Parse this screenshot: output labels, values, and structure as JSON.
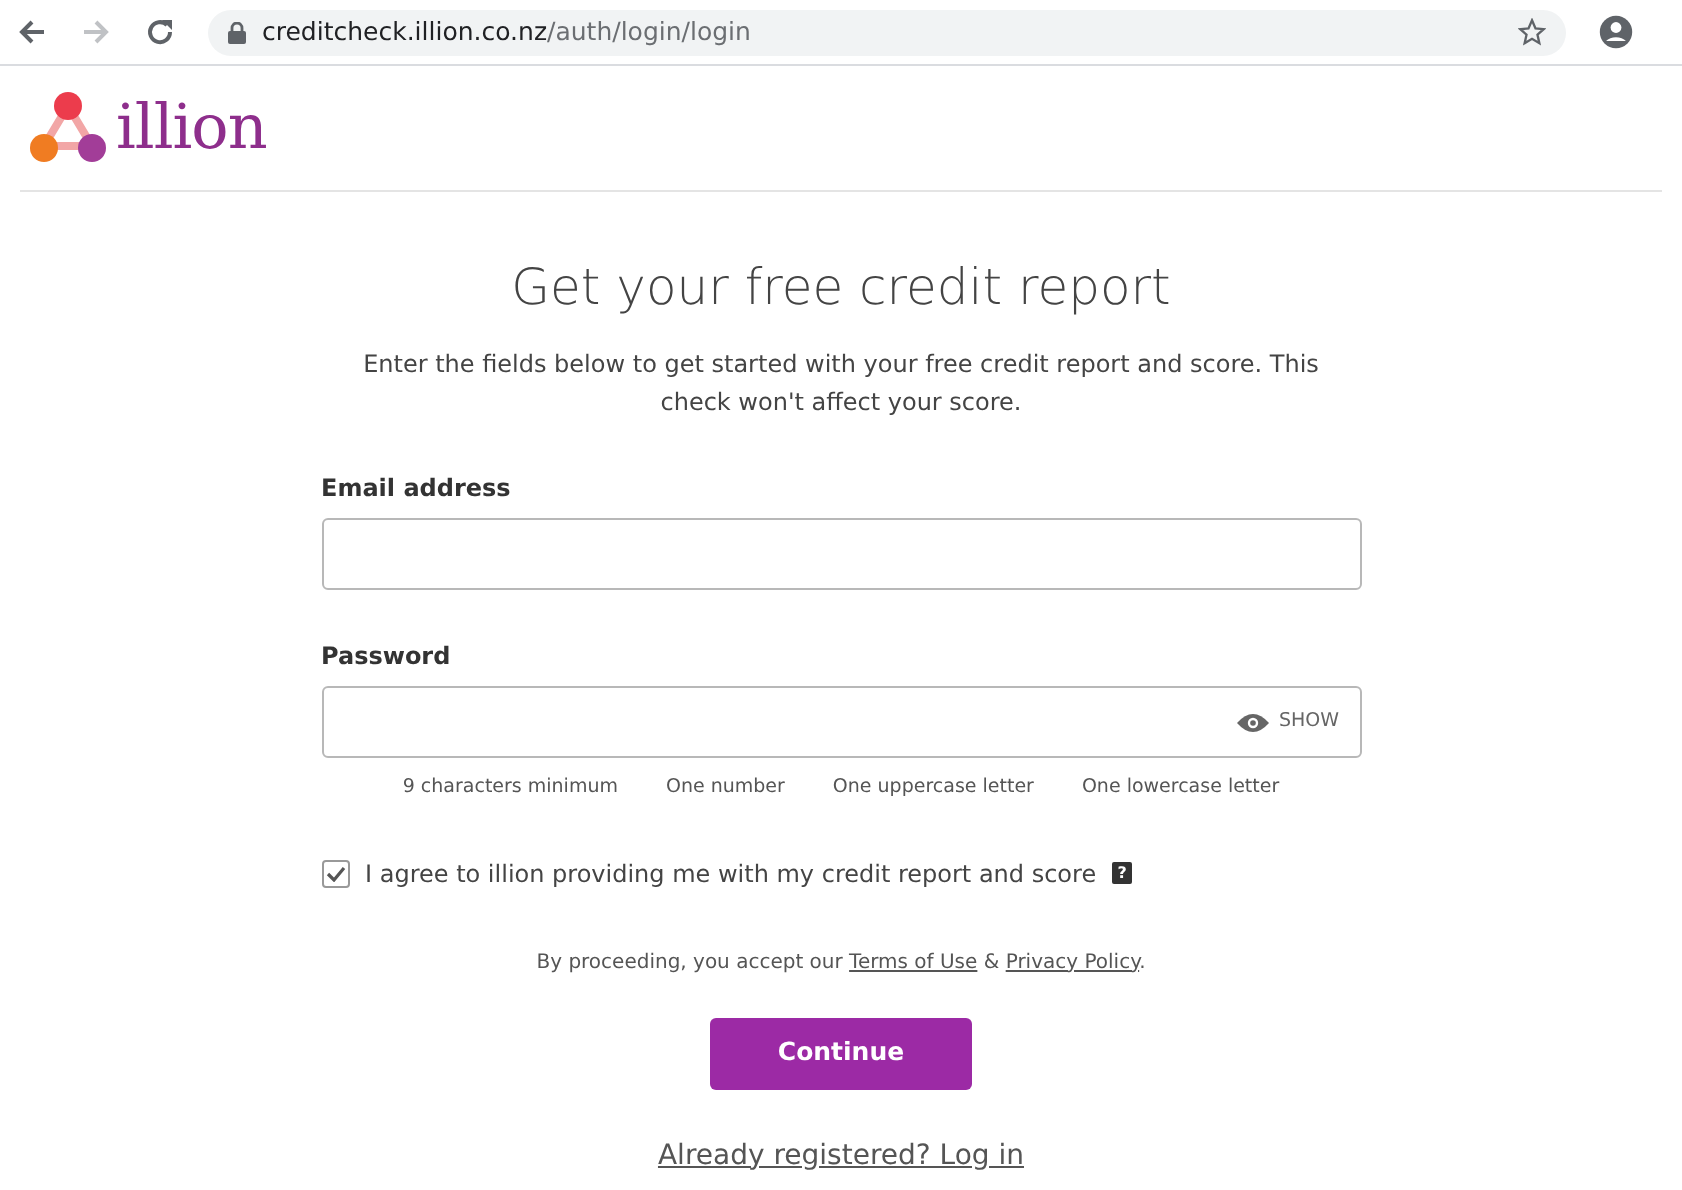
{
  "browser": {
    "url_host": "creditcheck.illion.co.nz",
    "url_path": "/auth/login/login"
  },
  "logo": {
    "text": "illion"
  },
  "heading": "Get your free credit report",
  "intro": "Enter the fields below to get started with your free credit report and score. This check won't affect your score.",
  "email": {
    "label": "Email address"
  },
  "password": {
    "label": "Password",
    "toggle": "SHOW"
  },
  "rules": [
    "9 characters minimum",
    "One number",
    "One uppercase letter",
    "One lowercase letter"
  ],
  "agree": {
    "label": "I agree to illion providing me with my credit report and score",
    "checked": true,
    "help": "?"
  },
  "legal": {
    "before": "By proceeding, you accept our ",
    "links": [
      "Terms of Use",
      "Privacy Policy"
    ],
    "between": " & ",
    "after": "."
  },
  "continue": "Continue",
  "login_link": "Already registered? Log in"
}
